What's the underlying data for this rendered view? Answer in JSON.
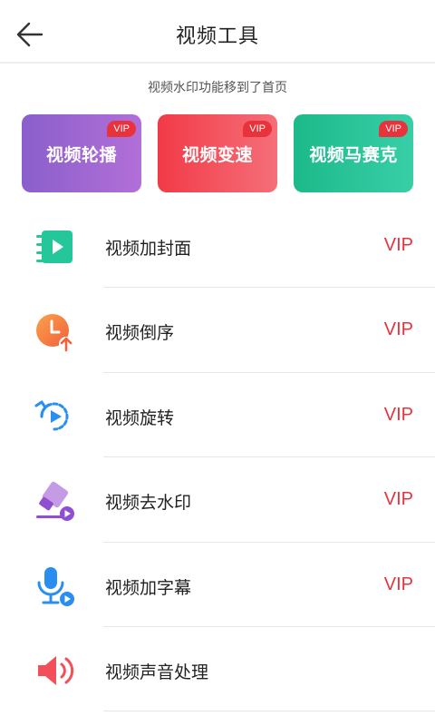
{
  "header": {
    "title": "视频工具",
    "back_icon": "back-arrow-icon"
  },
  "notice": "视频水印功能移到了首页",
  "cards": [
    {
      "label": "视频轮播",
      "badge": "VIP"
    },
    {
      "label": "视频变速",
      "badge": "VIP"
    },
    {
      "label": "视频马赛克",
      "badge": "VIP"
    }
  ],
  "tools": [
    {
      "label": "视频加封面",
      "badge": "VIP",
      "icon": "video-cover-icon"
    },
    {
      "label": "视频倒序",
      "badge": "VIP",
      "icon": "reverse-clock-icon"
    },
    {
      "label": "视频旋转",
      "badge": "VIP",
      "icon": "rotate-icon"
    },
    {
      "label": "视频去水印",
      "badge": "VIP",
      "icon": "eraser-icon"
    },
    {
      "label": "视频加字幕",
      "badge": "VIP",
      "icon": "microphone-icon"
    },
    {
      "label": "视频声音处理",
      "badge": "",
      "icon": "speaker-icon"
    }
  ],
  "colors": {
    "vip_red": "#e8323c",
    "purple": "#8a5fcb",
    "red": "#f23a47",
    "green": "#1cb98a"
  }
}
